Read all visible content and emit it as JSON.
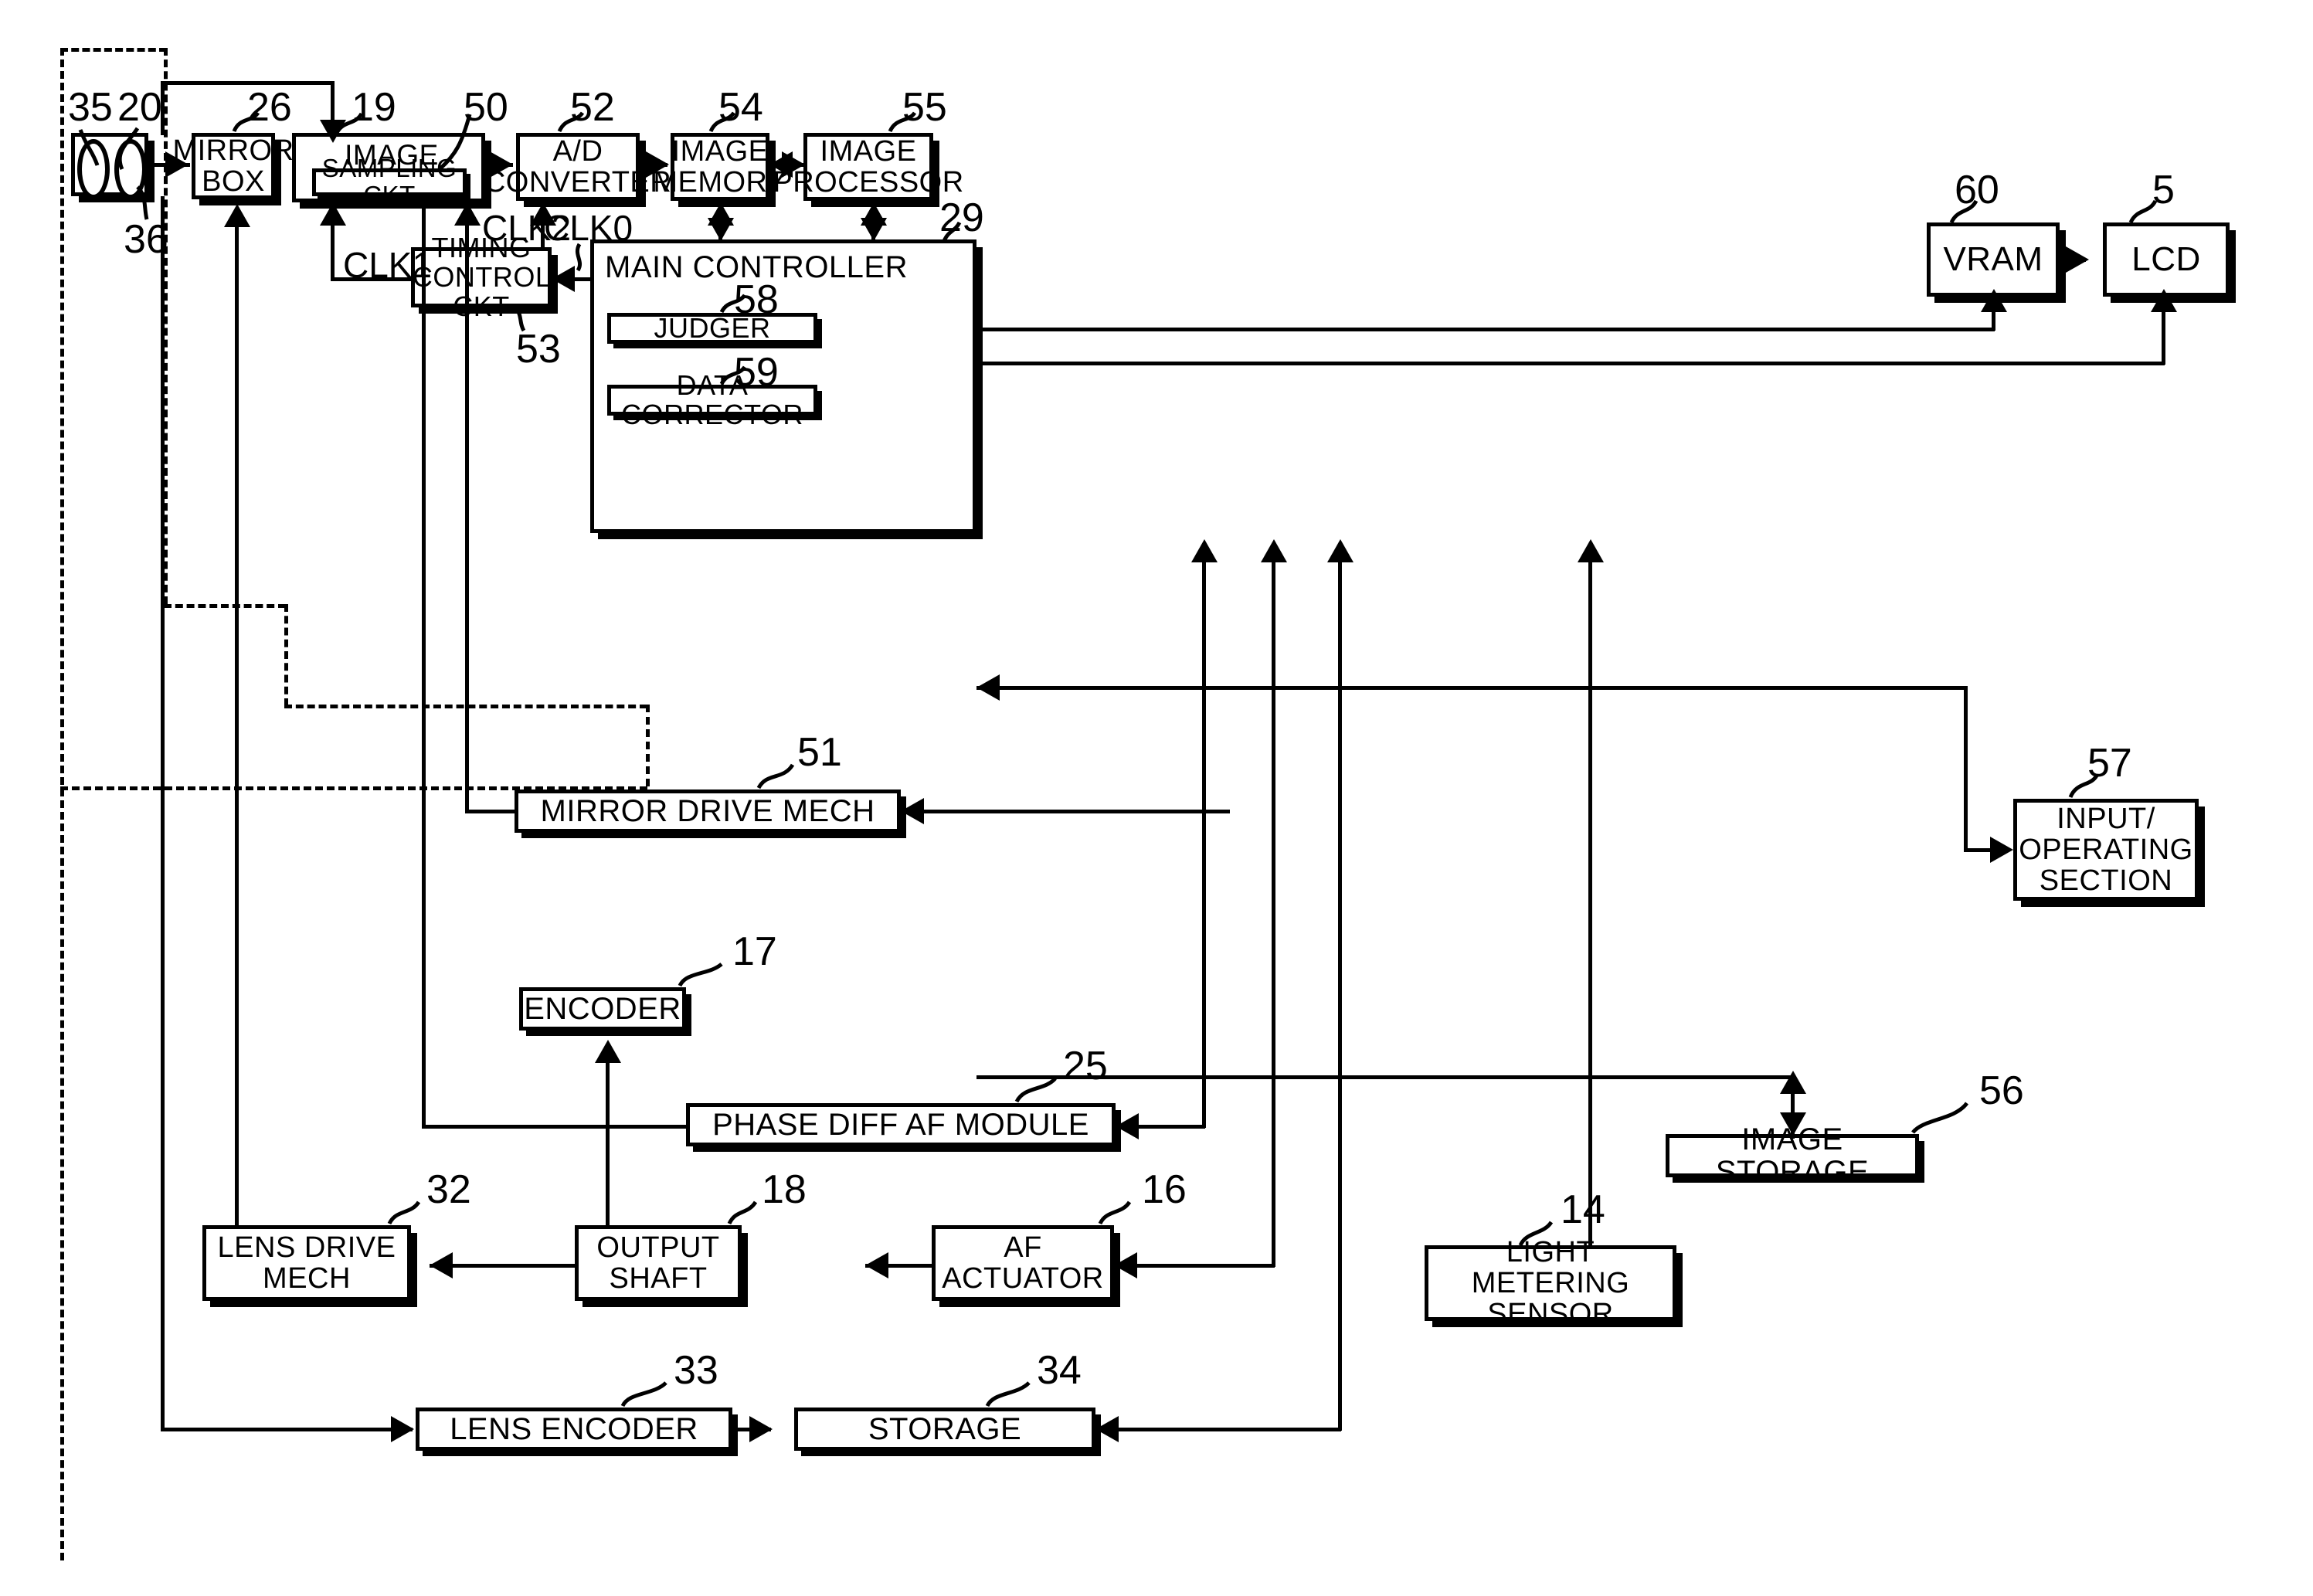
{
  "figure": {
    "type": "block-diagram",
    "subject": "camera imaging system block diagram"
  },
  "blocks": [
    {
      "id": "lens_unit",
      "label": "",
      "ref": "35"
    },
    {
      "id": "lens_group",
      "label": "",
      "ref": "20"
    },
    {
      "id": "aperture",
      "label": "",
      "ref": "36"
    },
    {
      "id": "mirror_box",
      "label": "MIRROR\nBOX",
      "ref": "26"
    },
    {
      "id": "image_sensor",
      "label": "IMAGE SENSOR",
      "ref": "19"
    },
    {
      "id": "sampling_ckt",
      "label": "SAMPLING CKT",
      "ref": "50"
    },
    {
      "id": "ad_converter",
      "label": "A/D\nCONVERTER",
      "ref": "52"
    },
    {
      "id": "image_memory",
      "label": "IMAGE\nMEMORY",
      "ref": "54"
    },
    {
      "id": "image_processor",
      "label": "IMAGE\nPROCESSOR",
      "ref": "55"
    },
    {
      "id": "vram",
      "label": "VRAM",
      "ref": "60"
    },
    {
      "id": "lcd",
      "label": "LCD",
      "ref": "5"
    },
    {
      "id": "main_controller",
      "label": "MAIN CONTROLLER",
      "ref": "29"
    },
    {
      "id": "judger",
      "label": "JUDGER",
      "ref": "58"
    },
    {
      "id": "data_corrector",
      "label": "DATA CORRECTOR",
      "ref": "59"
    },
    {
      "id": "timing_ctrl",
      "label": "TIMING\nCONTROL CKT",
      "ref": "53"
    },
    {
      "id": "mirror_drive",
      "label": "MIRROR DRIVE MECH",
      "ref": "51"
    },
    {
      "id": "input_section",
      "label": "INPUT/\nOPERATING\nSECTION",
      "ref": "57"
    },
    {
      "id": "encoder",
      "label": "ENCODER",
      "ref": "17"
    },
    {
      "id": "phase_af",
      "label": "PHASE DIFF AF MODULE",
      "ref": "25"
    },
    {
      "id": "image_storage",
      "label": "IMAGE STORAGE",
      "ref": "56"
    },
    {
      "id": "lens_drive",
      "label": "LENS DRIVE\nMECH",
      "ref": "32"
    },
    {
      "id": "output_shaft",
      "label": "OUTPUT\nSHAFT",
      "ref": "18"
    },
    {
      "id": "af_actuator",
      "label": "AF\nACTUATOR",
      "ref": "16"
    },
    {
      "id": "light_meter",
      "label": "LIGHT METERING\nSENSOR",
      "ref": "14"
    },
    {
      "id": "lens_encoder",
      "label": "LENS ENCODER",
      "ref": "33"
    },
    {
      "id": "storage",
      "label": "STORAGE",
      "ref": "34"
    }
  ],
  "text": {
    "mirror_box_l1": "MIRROR",
    "mirror_box_l2": "BOX",
    "image_sensor": "IMAGE SENSOR",
    "sampling_ckt": "SAMPLING CKT",
    "ad_l1": "A/D",
    "ad_l2": "CONVERTER",
    "imgmem_l1": "IMAGE",
    "imgmem_l2": "MEMORY",
    "imgproc_l1": "IMAGE",
    "imgproc_l2": "PROCESSOR",
    "vram": "VRAM",
    "lcd": "LCD",
    "main_controller": "MAIN CONTROLLER",
    "judger": "JUDGER",
    "data_corrector": "DATA CORRECTOR",
    "timing_l1": "TIMING",
    "timing_l2": "CONTROL CKT",
    "mirror_drive": "MIRROR DRIVE MECH",
    "input_l1": "INPUT/",
    "input_l2": "OPERATING",
    "input_l3": "SECTION",
    "encoder": "ENCODER",
    "phase_af": "PHASE DIFF AF MODULE",
    "image_storage": "IMAGE STORAGE",
    "lensdrive_l1": "LENS DRIVE",
    "lensdrive_l2": "MECH",
    "outshaft_l1": "OUTPUT",
    "outshaft_l2": "SHAFT",
    "afact_l1": "AF",
    "afact_l2": "ACTUATOR",
    "lightmeter_l1": "LIGHT METERING",
    "lightmeter_l2": "SENSOR",
    "lens_encoder": "LENS ENCODER",
    "storage": "STORAGE"
  },
  "refs": {
    "n35": "35",
    "n20": "20",
    "n36": "36",
    "n26": "26",
    "n19": "19",
    "n50": "50",
    "n52": "52",
    "n54": "54",
    "n55": "55",
    "n60": "60",
    "n5": "5",
    "n29": "29",
    "n58": "58",
    "n59": "59",
    "n53": "53",
    "n51": "51",
    "n57": "57",
    "n17": "17",
    "n25": "25",
    "n56": "56",
    "n32": "32",
    "n18": "18",
    "n16": "16",
    "n14": "14",
    "n33": "33",
    "n34": "34"
  },
  "signals": {
    "clk0": "CLK0",
    "clk1": "CLK1",
    "clk2": "CLK2"
  },
  "colors": {
    "line": "#000000",
    "background": "#ffffff"
  }
}
